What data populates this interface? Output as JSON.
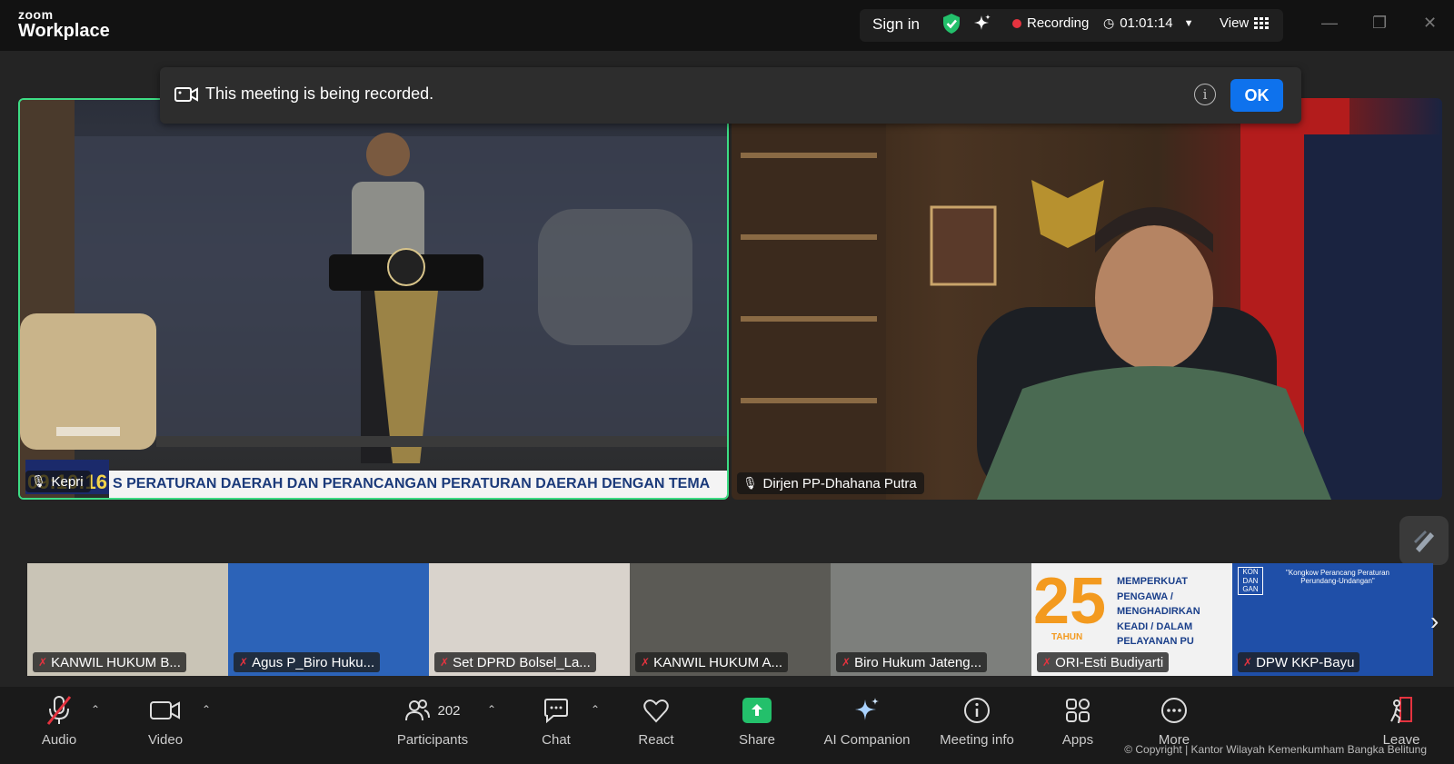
{
  "app": {
    "brand_small": "zoom",
    "brand_large": "Workplace"
  },
  "topbar": {
    "sign_in": "Sign in",
    "recording": "Recording",
    "timer": "01:01:14",
    "view": "View",
    "recording_color": "#e5333f",
    "shield_color": "#23c06b"
  },
  "banner": {
    "message": "This meeting is being recorded.",
    "ok_label": "OK"
  },
  "main_video": {
    "participant": "Kepri",
    "clock_text": "09:10:16",
    "ticker_text": "S PERATURAN DAERAH DAN PERANCANGAN PERATURAN DAERAH DENGAN TEMA"
  },
  "second_video": {
    "participant": "Dirjen PP-Dhahana Putra"
  },
  "thumbnails": [
    {
      "name": "KANWIL HUKUM B...",
      "bg": "#c9c4b6"
    },
    {
      "name": "Agus P_Biro Huku...",
      "bg": "#2c63b8"
    },
    {
      "name": "Set DPRD Bolsel_La...",
      "bg": "#d9d3cc"
    },
    {
      "name": "KANWIL HUKUM A...",
      "bg": "#5b5a55"
    },
    {
      "name": "Biro Hukum Jateng...",
      "bg": "#7d7f7c"
    },
    {
      "name": "ORI-Esti Budiyarti",
      "bg": "#f2f2f2",
      "overlay": "MEMPERKUAT PENGAWA / MENGHADIRKAN KEADI / DALAM PELAYANAN PU",
      "number": "25",
      "tahun": "TAHUN"
    },
    {
      "name": "DPW KKP-Bayu",
      "bg": "#1f4fa8",
      "overlay": "\"Kongkow Perancang Peraturan Perundang-Undangan\"",
      "badge": "KON DAN GAN"
    }
  ],
  "toolbar": {
    "audio": "Audio",
    "video": "Video",
    "participants": "Participants",
    "participants_count": "202",
    "chat": "Chat",
    "react": "React",
    "share": "Share",
    "ai_companion": "AI Companion",
    "meeting_info": "Meeting info",
    "apps": "Apps",
    "more": "More",
    "leave": "Leave"
  },
  "footer": {
    "copyright": "© Copyright | Kantor Wilayah Kemenkumham Bangka Belitung"
  }
}
